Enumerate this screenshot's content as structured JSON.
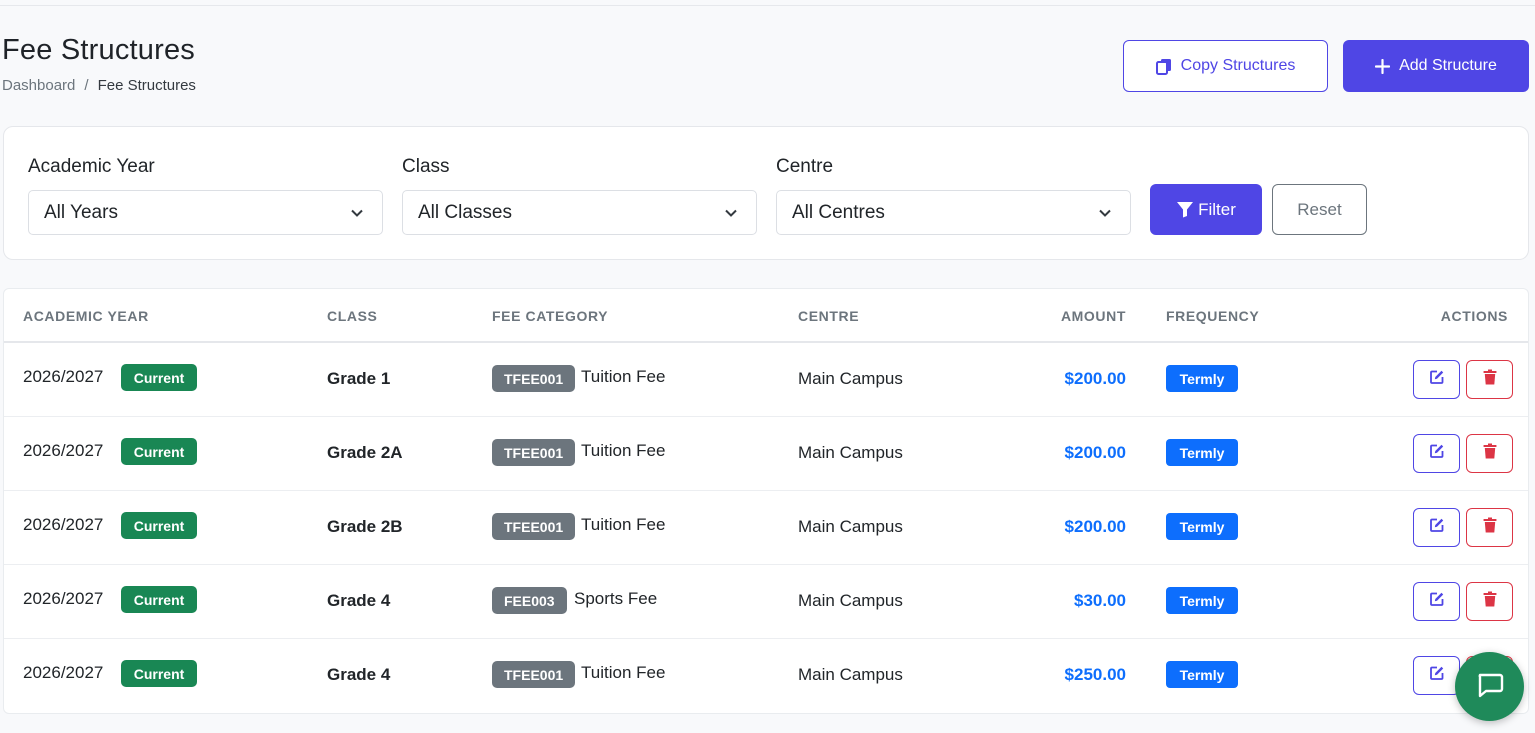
{
  "page": {
    "title": "Fee Structures",
    "breadcrumb": {
      "home": "Dashboard",
      "separator": "/",
      "current": "Fee Structures"
    }
  },
  "header_actions": {
    "copy_label": "Copy Structures",
    "add_label": "Add Structure"
  },
  "filters": {
    "academic_year": {
      "label": "Academic Year",
      "value": "All Years"
    },
    "class": {
      "label": "Class",
      "value": "All Classes"
    },
    "centre": {
      "label": "Centre",
      "value": "All Centres"
    },
    "filter_label": "Filter",
    "reset_label": "Reset"
  },
  "table": {
    "columns": [
      "ACADEMIC YEAR",
      "CLASS",
      "FEE CATEGORY",
      "CENTRE",
      "AMOUNT",
      "FREQUENCY",
      "ACTIONS"
    ],
    "rows": [
      {
        "year": "2026/2027",
        "status": "Current",
        "class": "Grade 1",
        "fee_code": "TFEE001",
        "fee_name": "Tuition Fee",
        "centre": "Main Campus",
        "amount": "$200.00",
        "frequency": "Termly"
      },
      {
        "year": "2026/2027",
        "status": "Current",
        "class": "Grade 2A",
        "fee_code": "TFEE001",
        "fee_name": "Tuition Fee",
        "centre": "Main Campus",
        "amount": "$200.00",
        "frequency": "Termly"
      },
      {
        "year": "2026/2027",
        "status": "Current",
        "class": "Grade 2B",
        "fee_code": "TFEE001",
        "fee_name": "Tuition Fee",
        "centre": "Main Campus",
        "amount": "$200.00",
        "frequency": "Termly"
      },
      {
        "year": "2026/2027",
        "status": "Current",
        "class": "Grade 4",
        "fee_code": "FEE003",
        "fee_name": "Sports Fee",
        "centre": "Main Campus",
        "amount": "$30.00",
        "frequency": "Termly"
      },
      {
        "year": "2026/2027",
        "status": "Current",
        "class": "Grade 4",
        "fee_code": "TFEE001",
        "fee_name": "Tuition Fee",
        "centre": "Main Campus",
        "amount": "$250.00",
        "frequency": "Termly"
      }
    ]
  },
  "icons": {
    "copy": "copy-icon",
    "add": "plus-icon",
    "filter": "funnel-icon",
    "edit": "edit-icon",
    "delete": "trash-icon",
    "chat": "chat-icon",
    "select": "chevron-down-icon"
  },
  "colors": {
    "primary": "#4f46e5",
    "success": "#198754",
    "info": "#0d6efd",
    "secondary": "#6c757d",
    "danger": "#dc3545",
    "chat": "#1f8a5a"
  }
}
